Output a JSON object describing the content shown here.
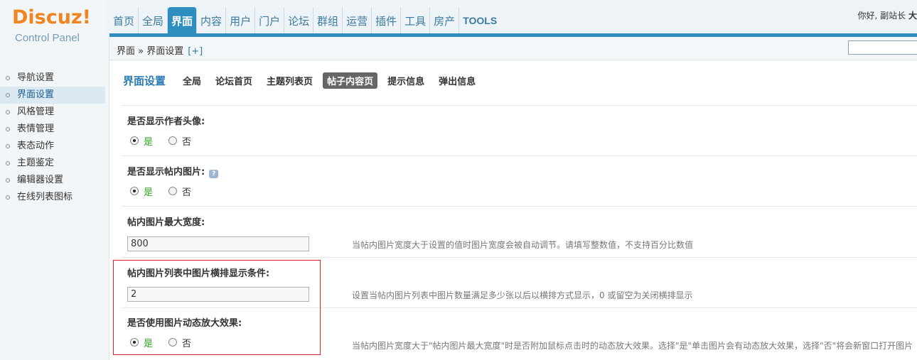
{
  "logo": {
    "title": "Discuz!",
    "subtitle": "Control Panel"
  },
  "topnav": {
    "tabs": [
      "首页",
      "全局",
      "界面",
      "内容",
      "用户",
      "门户",
      "论坛",
      "群组",
      "运营",
      "插件",
      "工具",
      "房产",
      "TOOLS"
    ],
    "active": "界面"
  },
  "greeting": {
    "text": "你好, 副站长",
    "name": "大"
  },
  "breadcrumb": {
    "path": "界面 » 界面设置",
    "plus": "[+]"
  },
  "sidebar": {
    "items": [
      {
        "label": "导航设置"
      },
      {
        "label": "界面设置"
      },
      {
        "label": "风格管理"
      },
      {
        "label": "表情管理"
      },
      {
        "label": "表态动作"
      },
      {
        "label": "主题鉴定"
      },
      {
        "label": "编辑器设置"
      },
      {
        "label": "在线列表图标"
      }
    ],
    "active": "界面设置"
  },
  "main": {
    "title": "界面设置",
    "subtabs": [
      "全局",
      "论坛首页",
      "主题列表页",
      "帖子内容页",
      "提示信息",
      "弹出信息"
    ],
    "active_subtab": "帖子内容页",
    "settings": {
      "avatar": {
        "label": "是否显示作者头像:",
        "yes": "是",
        "no": "否",
        "selected": "是"
      },
      "inline_images": {
        "label": "是否显示帖内图片:",
        "yes": "是",
        "no": "否",
        "selected": "是"
      },
      "max_width": {
        "label": "帖内图片最大宽度:",
        "value": "800",
        "hint": "当帖内图片宽度大于设置的值时图片宽度会被自动调节。请填写整数值，不支持百分比数值"
      },
      "horizontal_condition": {
        "label": "帖内图片列表中图片横排显示条件:",
        "value": "2",
        "hint": "设置当帖内图片列表中图片数量满足多少张以后以横排方式显示，0 或留空为关闭横排显示"
      },
      "zoom_effect": {
        "label": "是否使用图片动态放大效果:",
        "yes": "是",
        "no": "否",
        "selected": "是",
        "hint": "当帖内图片宽度大于\"帖内图片最大宽度\"时是否附加鼠标点击时的动态放大效果。选择\"是\"单击图片会有动态放大效果，选择\"否\"将会新窗口打开图片"
      }
    }
  },
  "colors": {
    "accent": "#2f8ec0",
    "logo": "#f0841f",
    "highlight_box": "#dd2222",
    "yes_option": "#2ea81f"
  }
}
